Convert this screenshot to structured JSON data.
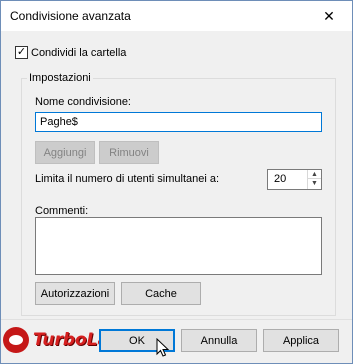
{
  "window": {
    "title": "Condivisione avanzata",
    "close_glyph": "✕"
  },
  "share_checkbox": {
    "label": "Condividi la cartella",
    "checked": true
  },
  "settings": {
    "group_title": "Impostazioni",
    "name_label": "Nome condivisione:",
    "name_value": "Paghe$",
    "add_button": "Aggiungi",
    "remove_button": "Rimuovi",
    "limit_label": "Limita il numero di utenti simultanei a:",
    "limit_value": "20",
    "comments_label": "Commenti:",
    "comments_value": "",
    "permissions_button": "Autorizzazioni",
    "cache_button": "Cache"
  },
  "footer": {
    "ok_button": "OK",
    "cancel_button": "Annulla",
    "apply_button": "Applica"
  },
  "watermark": {
    "text": "TurboLab.it"
  },
  "colors": {
    "accent": "#0078d7",
    "watermark": "#d62020"
  }
}
